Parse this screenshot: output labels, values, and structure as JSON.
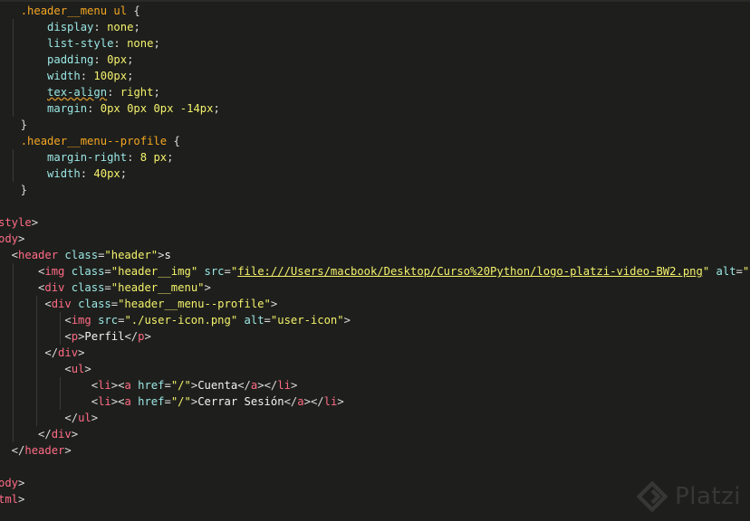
{
  "editor": {
    "lines": [
      [
        {
          "t": "  ",
          "c": "text"
        },
        {
          "t": ".header__menu ul",
          "c": "sel"
        },
        {
          "t": " {",
          "c": "punc"
        }
      ],
      [
        {
          "t": "      ",
          "c": "text"
        },
        {
          "t": "display",
          "c": "prop"
        },
        {
          "t": ": ",
          "c": "punc"
        },
        {
          "t": "none",
          "c": "val"
        },
        {
          "t": ";",
          "c": "punc"
        }
      ],
      [
        {
          "t": "      ",
          "c": "text"
        },
        {
          "t": "list-style",
          "c": "prop"
        },
        {
          "t": ": ",
          "c": "punc"
        },
        {
          "t": "none",
          "c": "val"
        },
        {
          "t": ";",
          "c": "punc"
        }
      ],
      [
        {
          "t": "      ",
          "c": "text"
        },
        {
          "t": "padding",
          "c": "prop"
        },
        {
          "t": ": ",
          "c": "punc"
        },
        {
          "t": "0px",
          "c": "num"
        },
        {
          "t": ";",
          "c": "punc"
        }
      ],
      [
        {
          "t": "      ",
          "c": "text"
        },
        {
          "t": "width",
          "c": "prop"
        },
        {
          "t": ": ",
          "c": "punc"
        },
        {
          "t": "100px",
          "c": "num"
        },
        {
          "t": ";",
          "c": "punc"
        }
      ],
      [
        {
          "t": "      ",
          "c": "text"
        },
        {
          "t": "tex-align",
          "c": "prop err"
        },
        {
          "t": ": ",
          "c": "punc"
        },
        {
          "t": "right",
          "c": "val"
        },
        {
          "t": ";",
          "c": "punc"
        }
      ],
      [
        {
          "t": "      ",
          "c": "text"
        },
        {
          "t": "margin",
          "c": "prop"
        },
        {
          "t": ": ",
          "c": "punc"
        },
        {
          "t": "0px 0px 0px -14px",
          "c": "num"
        },
        {
          "t": ";",
          "c": "punc"
        }
      ],
      [
        {
          "t": "  }",
          "c": "punc"
        }
      ],
      [
        {
          "t": "  ",
          "c": "text"
        },
        {
          "t": ".header__menu--profile",
          "c": "sel"
        },
        {
          "t": " {",
          "c": "punc"
        }
      ],
      [
        {
          "t": "      ",
          "c": "text"
        },
        {
          "t": "margin-right",
          "c": "prop"
        },
        {
          "t": ": ",
          "c": "punc"
        },
        {
          "t": "8 px",
          "c": "num"
        },
        {
          "t": ";",
          "c": "punc"
        }
      ],
      [
        {
          "t": "      ",
          "c": "text"
        },
        {
          "t": "width",
          "c": "prop"
        },
        {
          "t": ": ",
          "c": "punc"
        },
        {
          "t": "40px",
          "c": "num"
        },
        {
          "t": ";",
          "c": "punc"
        }
      ],
      [
        {
          "t": "  }",
          "c": "punc"
        }
      ],
      [],
      [
        {
          "t": "style",
          "c": "tag"
        },
        {
          "t": ">",
          "c": "punc"
        }
      ],
      [
        {
          "t": "ody",
          "c": "tag"
        },
        {
          "t": ">",
          "c": "punc"
        }
      ],
      [
        {
          "t": "  <",
          "c": "punc"
        },
        {
          "t": "header",
          "c": "tag"
        },
        {
          "t": " ",
          "c": "text"
        },
        {
          "t": "class",
          "c": "attr"
        },
        {
          "t": "=",
          "c": "punc"
        },
        {
          "t": "\"header\"",
          "c": "str"
        },
        {
          "t": ">",
          "c": "punc"
        },
        {
          "t": "s",
          "c": "text"
        }
      ],
      [
        {
          "t": "      <",
          "c": "punc"
        },
        {
          "t": "img",
          "c": "tag"
        },
        {
          "t": " ",
          "c": "text"
        },
        {
          "t": "class",
          "c": "attr"
        },
        {
          "t": "=",
          "c": "punc"
        },
        {
          "t": "\"header__img\"",
          "c": "str"
        },
        {
          "t": " ",
          "c": "text"
        },
        {
          "t": "src",
          "c": "attr"
        },
        {
          "t": "=",
          "c": "punc"
        },
        {
          "t": "\"",
          "c": "str"
        },
        {
          "t": "file:///Users/macbook/Desktop/Curso%20Python/logo-platzi-video-BW2.png",
          "c": "link"
        },
        {
          "t": "\"",
          "c": "str"
        },
        {
          "t": " ",
          "c": "text"
        },
        {
          "t": "alt",
          "c": "attr"
        },
        {
          "t": "=",
          "c": "punc"
        },
        {
          "t": "\"\"",
          "c": "str"
        }
      ],
      [
        {
          "t": "      <",
          "c": "punc"
        },
        {
          "t": "div",
          "c": "tag"
        },
        {
          "t": " ",
          "c": "text"
        },
        {
          "t": "class",
          "c": "attr"
        },
        {
          "t": "=",
          "c": "punc"
        },
        {
          "t": "\"header__menu\"",
          "c": "str"
        },
        {
          "t": ">",
          "c": "punc"
        }
      ],
      [
        {
          "t": "       <",
          "c": "punc"
        },
        {
          "t": "div",
          "c": "tag"
        },
        {
          "t": " ",
          "c": "text"
        },
        {
          "t": "class",
          "c": "attr"
        },
        {
          "t": "=",
          "c": "punc"
        },
        {
          "t": "\"header__menu--profile\"",
          "c": "str"
        },
        {
          "t": ">",
          "c": "punc"
        }
      ],
      [
        {
          "t": "          <",
          "c": "punc"
        },
        {
          "t": "img",
          "c": "tag"
        },
        {
          "t": " ",
          "c": "text"
        },
        {
          "t": "src",
          "c": "attr"
        },
        {
          "t": "=",
          "c": "punc"
        },
        {
          "t": "\"./user-icon.png\"",
          "c": "str"
        },
        {
          "t": " ",
          "c": "text"
        },
        {
          "t": "alt",
          "c": "attr"
        },
        {
          "t": "=",
          "c": "punc"
        },
        {
          "t": "\"user-icon\"",
          "c": "str"
        },
        {
          "t": ">",
          "c": "punc"
        }
      ],
      [
        {
          "t": "          <",
          "c": "punc"
        },
        {
          "t": "p",
          "c": "tag"
        },
        {
          "t": ">",
          "c": "punc"
        },
        {
          "t": "Perfil",
          "c": "text"
        },
        {
          "t": "</",
          "c": "punc"
        },
        {
          "t": "p",
          "c": "tag"
        },
        {
          "t": ">",
          "c": "punc"
        }
      ],
      [
        {
          "t": "       </",
          "c": "punc"
        },
        {
          "t": "div",
          "c": "tag"
        },
        {
          "t": ">",
          "c": "punc"
        }
      ],
      [
        {
          "t": "          <",
          "c": "punc"
        },
        {
          "t": "ul",
          "c": "tag"
        },
        {
          "t": ">",
          "c": "punc"
        }
      ],
      [
        {
          "t": "              <",
          "c": "punc"
        },
        {
          "t": "li",
          "c": "tag"
        },
        {
          "t": "><",
          "c": "punc"
        },
        {
          "t": "a",
          "c": "tag"
        },
        {
          "t": " ",
          "c": "text"
        },
        {
          "t": "href",
          "c": "attr"
        },
        {
          "t": "=",
          "c": "punc"
        },
        {
          "t": "\"/\"",
          "c": "str"
        },
        {
          "t": ">",
          "c": "punc"
        },
        {
          "t": "Cuenta",
          "c": "text"
        },
        {
          "t": "</",
          "c": "punc"
        },
        {
          "t": "a",
          "c": "tag"
        },
        {
          "t": "></",
          "c": "punc"
        },
        {
          "t": "li",
          "c": "tag"
        },
        {
          "t": ">",
          "c": "punc"
        }
      ],
      [
        {
          "t": "              <",
          "c": "punc"
        },
        {
          "t": "li",
          "c": "tag"
        },
        {
          "t": "><",
          "c": "punc"
        },
        {
          "t": "a",
          "c": "tag"
        },
        {
          "t": " ",
          "c": "text"
        },
        {
          "t": "href",
          "c": "attr"
        },
        {
          "t": "=",
          "c": "punc"
        },
        {
          "t": "\"/\"",
          "c": "str"
        },
        {
          "t": ">",
          "c": "punc"
        },
        {
          "t": "Cerrar Sesión",
          "c": "text"
        },
        {
          "t": "</",
          "c": "punc"
        },
        {
          "t": "a",
          "c": "tag"
        },
        {
          "t": "></",
          "c": "punc"
        },
        {
          "t": "li",
          "c": "tag"
        },
        {
          "t": ">",
          "c": "punc"
        }
      ],
      [
        {
          "t": "          </",
          "c": "punc"
        },
        {
          "t": "ul",
          "c": "tag"
        },
        {
          "t": ">",
          "c": "punc"
        }
      ],
      [
        {
          "t": "      </",
          "c": "punc"
        },
        {
          "t": "div",
          "c": "tag"
        },
        {
          "t": ">",
          "c": "punc"
        }
      ],
      [
        {
          "t": "  </",
          "c": "punc"
        },
        {
          "t": "header",
          "c": "tag"
        },
        {
          "t": ">",
          "c": "punc"
        }
      ],
      [],
      [
        {
          "t": "ody",
          "c": "tag"
        },
        {
          "t": ">",
          "c": "punc"
        }
      ],
      [
        {
          "t": "tml",
          "c": "tag"
        },
        {
          "t": ">",
          "c": "punc"
        }
      ]
    ]
  },
  "watermark": {
    "text": "Platzi",
    "icon": "platzi-logo-icon"
  },
  "colors": {
    "background": "#1e1f1c",
    "selector": "#f5a623",
    "property": "#9be7e6",
    "value": "#f4f16c",
    "tag": "#ff6b86"
  }
}
